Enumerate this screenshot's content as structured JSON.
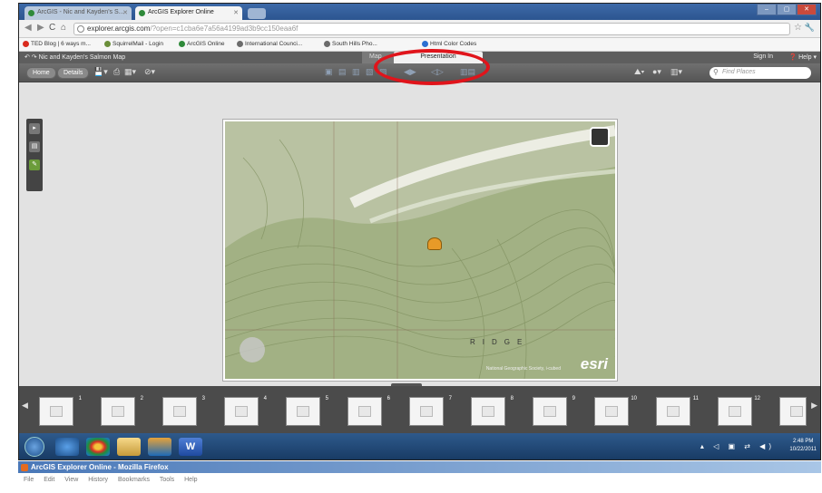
{
  "browser": {
    "tabs": [
      {
        "label": "ArcGIS - Nic and Kayden's S..."
      },
      {
        "label": "ArcGIS Explorer Online"
      }
    ],
    "url_host": "explorer.arcgis.com",
    "url_rest": "/?open=c1cba6e7a56a4199ad3b9cc150eaa6f",
    "bookmarks": [
      {
        "label": "TED Blog | 6 ways m...",
        "color": "#d92b1e"
      },
      {
        "label": "SquirrelMail - Login",
        "color": "#6b8f3a"
      },
      {
        "label": "ArcGIS Online",
        "color": "#2f8a3a"
      },
      {
        "label": "International Counci...",
        "color": "#6c6c6c"
      },
      {
        "label": "South Hills Pho...",
        "color": "#6c6c6c"
      },
      {
        "label": "Html Color Codes",
        "color": "#2a6fd1"
      }
    ]
  },
  "app": {
    "title": "Nic and Kayden's Salmon Map",
    "mode_tabs": {
      "map": "Map",
      "presentation": "Presentation"
    },
    "sign_in": "Sign In",
    "help": "Help",
    "home_button": "Home",
    "details_button": "Details",
    "find_placeholder": "Find Places"
  },
  "map": {
    "ridge_label": "RIDGE",
    "attribution": "National Geographic Society, i-cubed",
    "logo": "esri"
  },
  "slides": {
    "numbers": [
      "1",
      "2",
      "3",
      "4",
      "5",
      "6",
      "7",
      "8",
      "9",
      "10",
      "11",
      "12"
    ]
  },
  "taskbar": {
    "time": "2:48 PM",
    "date": "10/22/2011"
  },
  "firefox": {
    "title": "ArcGIS Explorer Online - Mozilla Firefox",
    "menu": [
      "File",
      "Edit",
      "View",
      "History",
      "Bookmarks",
      "Tools",
      "Help"
    ]
  },
  "colors": {
    "highlight": "#e0141b",
    "app_header": "#5e5e5e",
    "taskbar": "#173962"
  }
}
